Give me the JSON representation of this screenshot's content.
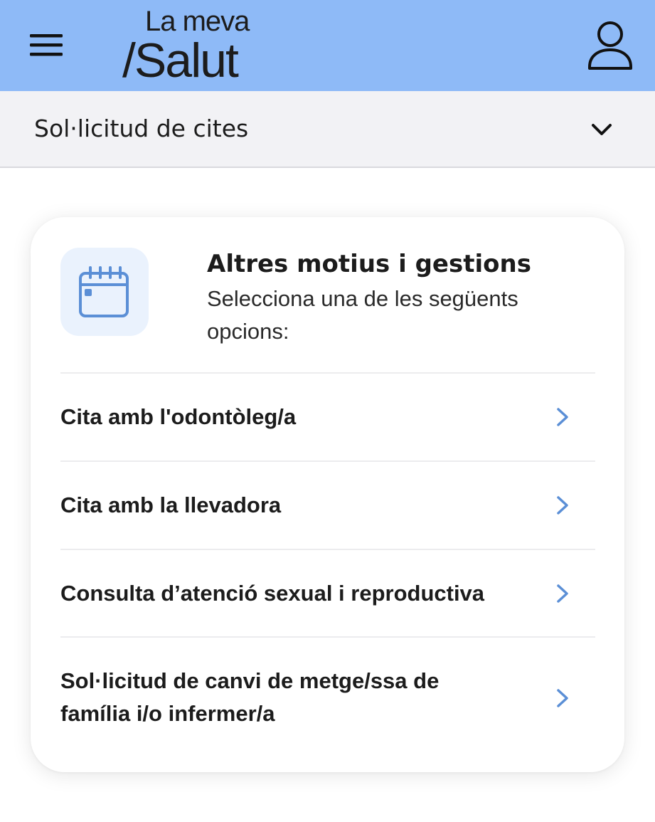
{
  "header": {
    "logo_line1": "La meva",
    "logo_line2": "/Salut",
    "menu_icon": "hamburger-menu-icon",
    "profile_icon": "user-profile-icon",
    "background_color": "#8ebaf7"
  },
  "section": {
    "title": "Sol·licitud de cites",
    "expand_icon": "chevron-down-icon"
  },
  "card": {
    "icon": "calendar-icon",
    "title": "Altres motius i gestions",
    "subtitle": "Selecciona una de les següents opcions:",
    "options": [
      {
        "label": "Cita amb l'odontòleg/a"
      },
      {
        "label": "Cita amb la llevadora"
      },
      {
        "label": "Consulta d’atenció sexual i reproductiva"
      },
      {
        "label": "Sol·licitud de canvi de metge/ssa de família i/o infermer/a"
      }
    ]
  },
  "colors": {
    "accent": "#5b8fd6",
    "icon_background": "#eaf2fd"
  }
}
